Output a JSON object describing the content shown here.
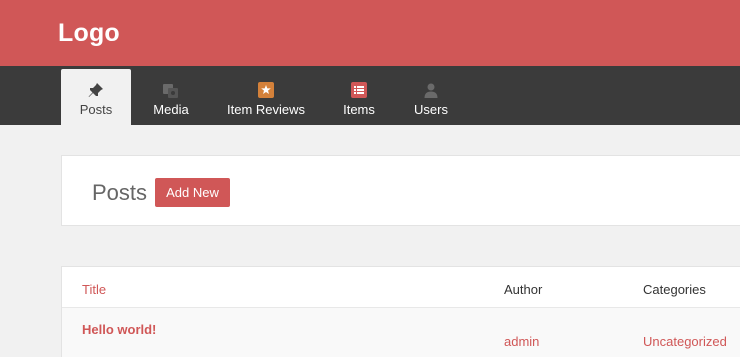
{
  "header": {
    "logo": "Logo",
    "background": "#d05757"
  },
  "nav": {
    "background": "#3b3b3b",
    "tabs": [
      {
        "label": "Posts",
        "icon": "pin-icon",
        "active": true
      },
      {
        "label": "Media",
        "icon": "media-icon",
        "active": false
      },
      {
        "label": "Item Reviews",
        "icon": "star-icon",
        "active": false
      },
      {
        "label": "Items",
        "icon": "list-icon",
        "active": false
      },
      {
        "label": "Users",
        "icon": "user-icon",
        "active": false
      }
    ]
  },
  "page": {
    "title": "Posts",
    "add_new_label": "Add New"
  },
  "table": {
    "columns": [
      "Title",
      "Author",
      "Categories"
    ],
    "rows": [
      {
        "title": "Hello world!",
        "author": "admin",
        "category": "Uncategorized"
      }
    ]
  },
  "colors": {
    "accent": "#d05757",
    "page_bg": "#f1f1f1"
  }
}
